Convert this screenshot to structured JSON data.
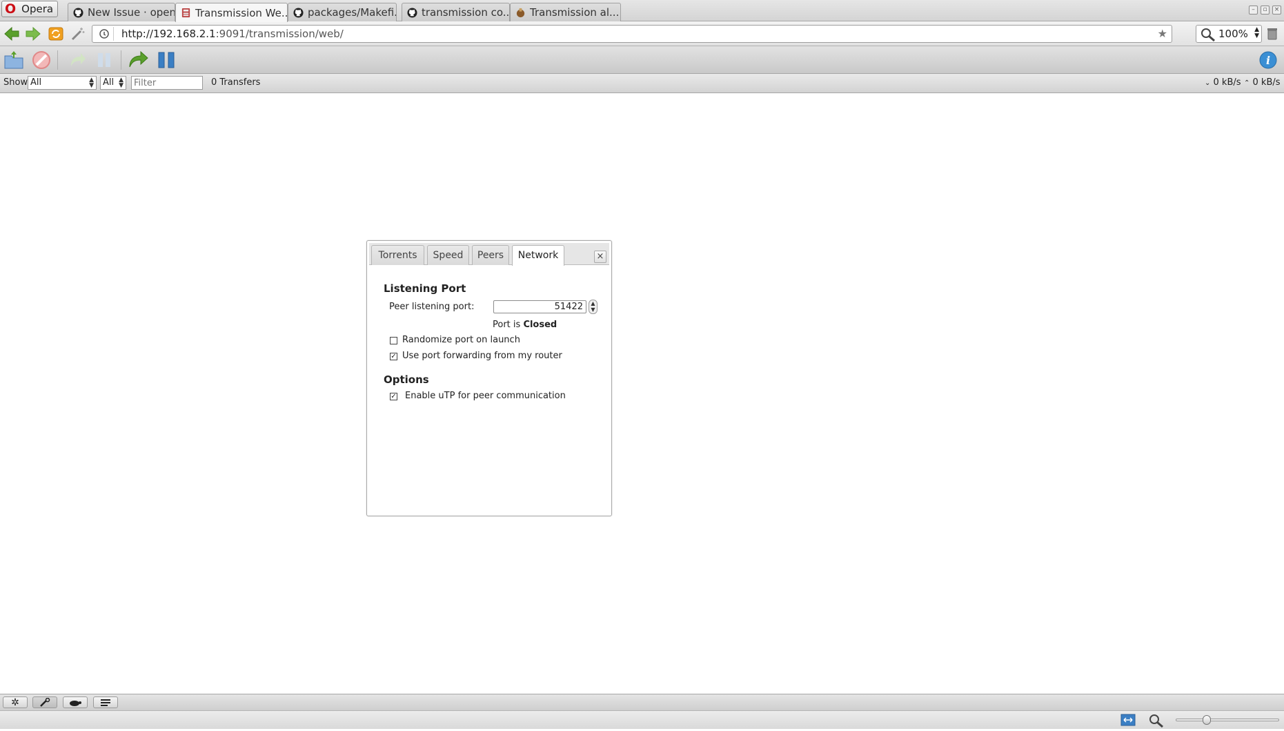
{
  "browser": {
    "menu_label": "Opera",
    "tabs": [
      {
        "label": "New Issue · open...",
        "icon": "github-icon"
      },
      {
        "label": "Transmission We...",
        "icon": "transmission-icon",
        "active": true
      },
      {
        "label": "packages/Makefi...",
        "icon": "github-icon"
      },
      {
        "label": "transmission co...",
        "icon": "github-icon"
      },
      {
        "label": "Transmission al...",
        "icon": "transmission-icon"
      }
    ],
    "url_host": "http://192.168.2.1",
    "url_rest": ":9091/transmission/web/",
    "zoom": "100%"
  },
  "toolbar": {
    "icons": [
      "open-torrent-icon",
      "remove-icon",
      "resume-icon",
      "pause-icon",
      "resume-all-icon",
      "pause-all-icon",
      "inspector-icon"
    ]
  },
  "filterbar": {
    "show_label": "Show",
    "state_filter": "All",
    "tracker_filter": "All",
    "filter_placeholder": "Filter",
    "transfers": "0 Transfers",
    "down_speed": "0 kB/s",
    "up_speed": "0 kB/s"
  },
  "prefs": {
    "tabs": [
      "Torrents",
      "Speed",
      "Peers",
      "Network"
    ],
    "active_tab": "Network",
    "listening_heading": "Listening Port",
    "peer_port_label": "Peer listening port:",
    "peer_port_value": "51422",
    "port_status_prefix": "Port is",
    "port_status": "Closed",
    "randomize_label": "Randomize port on launch",
    "randomize_checked": false,
    "forwarding_label": "Use port forwarding from my router",
    "forwarding_checked": true,
    "options_heading": "Options",
    "utp_label": "Enable uTP for peer communication",
    "utp_checked": true
  },
  "colors": {
    "opera_red": "#cc0f16",
    "green_arrow": "#5aa02c",
    "blue_pause": "#3b7fc4"
  }
}
